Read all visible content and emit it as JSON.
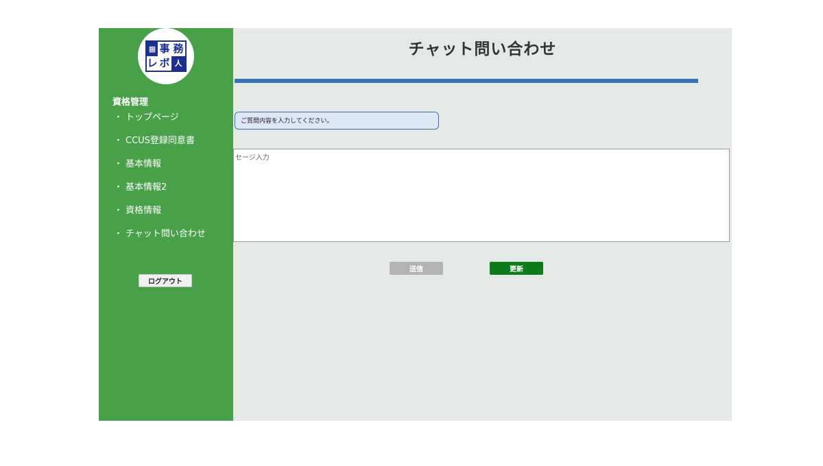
{
  "logo": {
    "cells": [
      "▦",
      "事",
      "務",
      "レ",
      "ボ",
      "人"
    ]
  },
  "sidebar": {
    "section_title": "資格管理",
    "items": [
      {
        "bullet": "・",
        "label": "トップページ"
      },
      {
        "bullet": "・",
        "label": "CCUS登録同意書"
      },
      {
        "bullet": "・",
        "label": "基本情報"
      },
      {
        "bullet": "・",
        "label": "基本情報2"
      },
      {
        "bullet": "・",
        "label": "資格情報"
      },
      {
        "bullet": "・",
        "label": "チャット問い合わせ"
      }
    ],
    "logout_label": "ログアウト"
  },
  "main": {
    "title": "チャット問い合わせ",
    "prompt": "ご質問内容を入力してください。",
    "message_placeholder": "セージ入力",
    "send_label": "送信",
    "refresh_label": "更新"
  },
  "colors": {
    "sidebar": "#48a048",
    "main_bg": "#e4e9e6",
    "divider": "#3373b3",
    "send_button": "#b3b3b3",
    "refresh_button": "#0f7a1a"
  }
}
